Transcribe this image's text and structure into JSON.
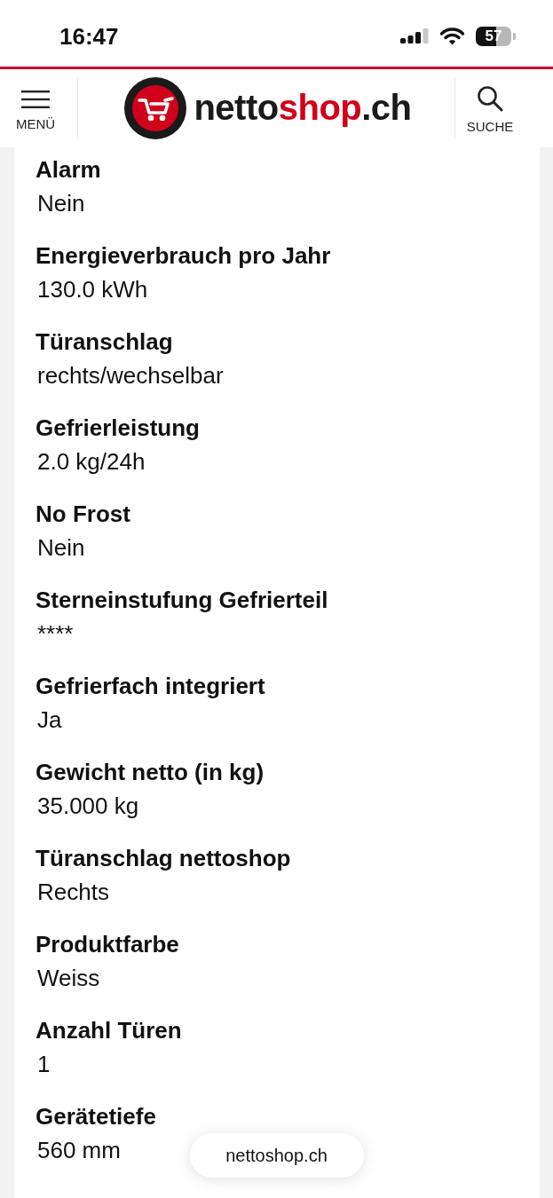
{
  "status_bar": {
    "time": "16:47",
    "battery": "57"
  },
  "header": {
    "menu_label": "MENÜ",
    "logo": [
      {
        "text": "netto",
        "accent": false
      },
      {
        "text": "shop",
        "accent": true
      },
      {
        "text": ".ch",
        "accent": false
      }
    ],
    "search_label": "SUCHE"
  },
  "specs": [
    {
      "label": "Alarm",
      "value": "Nein"
    },
    {
      "label": "Energieverbrauch pro Jahr",
      "value": "130.0 kWh"
    },
    {
      "label": "Türanschlag",
      "value": "rechts/wechselbar"
    },
    {
      "label": "Gefrierleistung",
      "value": "2.0 kg/24h"
    },
    {
      "label": "No Frost",
      "value": "Nein"
    },
    {
      "label": "Sterneinstufung Gefrierteil",
      "value": "****"
    },
    {
      "label": "Gefrierfach integriert",
      "value": "Ja"
    },
    {
      "label": "Gewicht netto (in kg)",
      "value": "35.000 kg"
    },
    {
      "label": "Türanschlag nettoshop",
      "value": "Rechts"
    },
    {
      "label": "Produktfarbe",
      "value": "Weiss"
    },
    {
      "label": "Anzahl Türen",
      "value": "1"
    },
    {
      "label": "Gerätetiefe",
      "value": "560 mm"
    }
  ],
  "url_pill": "nettoshop.ch"
}
